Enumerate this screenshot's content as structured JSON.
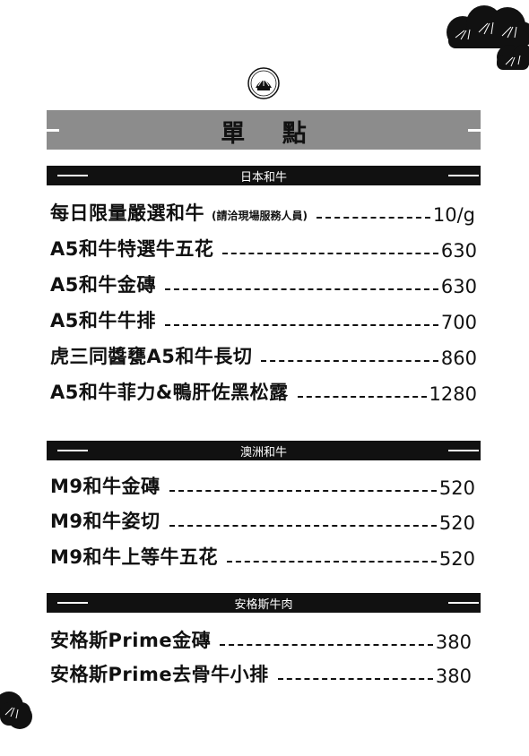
{
  "menu": {
    "title": "單 點",
    "sections": [
      {
        "title": "日本和牛",
        "items": [
          {
            "name": "每日限量嚴選和牛",
            "note": "(請洽現場服務人員)",
            "price": "10/g"
          },
          {
            "name": "A5和牛特選牛五花",
            "price": "630"
          },
          {
            "name": "A5和牛金磚",
            "price": "630"
          },
          {
            "name": "A5和牛牛排",
            "price": "700"
          },
          {
            "name": "虎三同醬甕A5和牛長切",
            "price": "860"
          },
          {
            "name": "A5和牛菲力&鴨肝佐黑松露",
            "price": "1280"
          }
        ]
      },
      {
        "title": "澳洲和牛",
        "items": [
          {
            "name": "M9和牛金磚",
            "price": "520"
          },
          {
            "name": "M9和牛姿切",
            "price": "520"
          },
          {
            "name": "M9和牛上等牛五花",
            "price": "520"
          }
        ]
      },
      {
        "title": "安格斯牛肉",
        "items": [
          {
            "name": "安格斯Prime金磚",
            "price": "380"
          },
          {
            "name": "安格斯Prime去骨牛小排",
            "price": "380"
          }
        ]
      }
    ]
  },
  "icons": {
    "emblem": "tiger-emblem-icon",
    "clouds": "cloud-icon"
  },
  "colors": {
    "title_bar": "#8c8c8c",
    "section_bar": "#111111",
    "text": "#111111"
  }
}
